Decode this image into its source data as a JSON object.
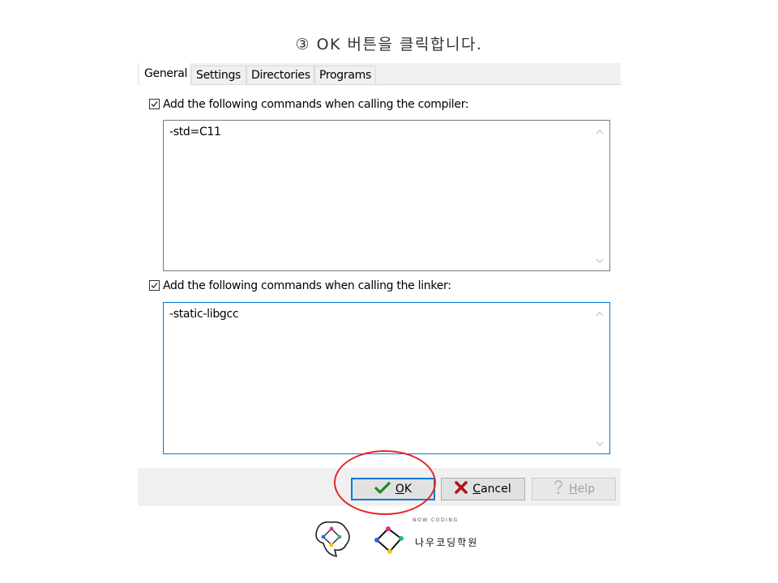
{
  "caption": "③ OK 버튼을 클릭합니다.",
  "dialog": {
    "tabs": [
      {
        "label": "General",
        "active": true
      },
      {
        "label": "Settings",
        "active": false
      },
      {
        "label": "Directories",
        "active": false
      },
      {
        "label": "Programs",
        "active": false
      }
    ],
    "compiler": {
      "checkbox_label": "Add the following commands when calling the compiler:",
      "checked": true,
      "value": "-std=C11"
    },
    "linker": {
      "checkbox_label": "Add the following commands when calling the linker:",
      "checked": true,
      "value": "-static-libgcc"
    },
    "buttons": {
      "ok": {
        "mnemonic": "O",
        "rest": "K",
        "icon": "checkmark-icon"
      },
      "cancel": {
        "mnemonic": "C",
        "rest": "ancel",
        "icon": "cross-icon"
      },
      "help": {
        "mnemonic": "H",
        "rest": "elp",
        "icon": "question-icon",
        "disabled": true
      }
    }
  },
  "highlight_color": "#e3262a",
  "logo": {
    "arc_text": "NOW CODING",
    "name": "나우코딩학원"
  }
}
